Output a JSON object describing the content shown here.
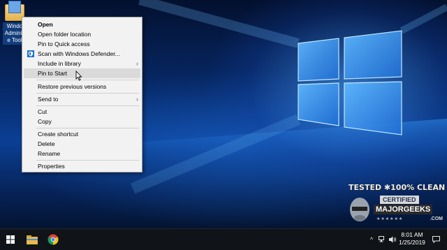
{
  "desktop": {
    "icon": {
      "label": "Windows Administrative Tools",
      "label_display": "Windo\nAdminis\ne Tool"
    }
  },
  "context_menu": {
    "items": [
      {
        "label": "Open",
        "bold": true
      },
      {
        "label": "Open folder location"
      },
      {
        "label": "Pin to Quick access"
      },
      {
        "label": "Scan with Windows Defender...",
        "icon": "windows-defender-icon"
      },
      {
        "label": "Include in library",
        "submenu": true
      },
      {
        "label": "Pin to Start",
        "hovered": true
      },
      {
        "label": "Restore previous versions"
      },
      {
        "label": "Send to",
        "submenu": true
      },
      {
        "label": "Cut"
      },
      {
        "label": "Copy"
      },
      {
        "label": "Create shortcut"
      },
      {
        "label": "Delete"
      },
      {
        "label": "Rename"
      },
      {
        "label": "Properties"
      }
    ],
    "submenu_arrow": "›"
  },
  "watermark": {
    "line1": "TESTED ✱100% CLEAN",
    "line2": "CERTIFIED",
    "line3": "MAJORGEEKS",
    "stars": "★★★★★★",
    "suffix": ".COM"
  },
  "taskbar": {
    "clock_time": "8:01 AM",
    "clock_date": "1/25/2019",
    "tray_chevron": "^",
    "colors": {
      "taskbar_bg": "#101317",
      "menu_bg": "#f2f2f2",
      "hover": "#dadada"
    }
  }
}
